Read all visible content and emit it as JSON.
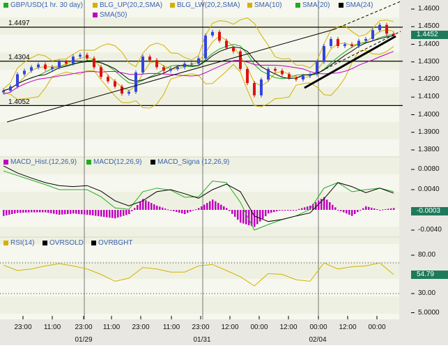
{
  "chart_data": {
    "type": "candlestick",
    "instrument": "GBP/USD(1 hr. 30 day)",
    "legend": [
      {
        "label": "GBP/USD(1 hr. 30 day)",
        "color": "#22aa22"
      },
      {
        "label": "BLG_UP(20,2,SMA)",
        "color": "#d4b000"
      },
      {
        "label": "BLG_LW(20,2,SMA)",
        "color": "#d4b000"
      },
      {
        "label": "SMA(10)",
        "color": "#d4b000"
      },
      {
        "label": "SMA(20)",
        "color": "#22aa22"
      },
      {
        "label": "SMA(24)",
        "color": "#000000"
      },
      {
        "label": "SMA(50)",
        "color": "#c000c0"
      }
    ],
    "closes": [
      1.4137,
      1.416,
      1.423,
      1.425,
      1.427,
      1.4285,
      1.426,
      1.427,
      1.43,
      1.429,
      1.433,
      1.434,
      1.432,
      1.427,
      1.4215,
      1.419,
      1.416,
      1.412,
      1.413,
      1.424,
      1.433,
      1.431,
      1.427,
      1.425,
      1.426,
      1.427,
      1.429,
      1.429,
      1.432,
      1.445,
      1.447,
      1.442,
      1.438,
      1.436,
      1.426,
      1.418,
      1.411,
      1.42,
      1.426,
      1.425,
      1.423,
      1.421,
      1.42,
      1.422,
      1.423,
      1.43,
      1.439,
      1.443,
      1.439,
      1.44,
      1.439,
      1.442,
      1.443,
      1.448,
      1.451,
      1.446,
      1.4452
    ],
    "levels": [
      {
        "label": "1.4497",
        "value": 1.4497
      },
      {
        "label": "1.4304",
        "value": 1.4304
      },
      {
        "label": "1.4052",
        "value": 1.4052
      }
    ],
    "price_axis": {
      "ylim": [
        1.375,
        1.465
      ],
      "ticks": [
        "1.4600",
        "1.4500",
        "1.4400",
        "1.4300",
        "1.4200",
        "1.4100",
        "1.4000",
        "1.3900",
        "1.3800"
      ],
      "tick_values": [
        1.46,
        1.45,
        1.44,
        1.43,
        1.42,
        1.41,
        1.4,
        1.39,
        1.38
      ],
      "last": "1.4452",
      "last_value": 1.4452
    },
    "macd_panel": {
      "legend": [
        {
          "label": "MACD_Hist.(12,26,9)",
          "color": "#c000c0"
        },
        {
          "label": "MACD(12,26,9)",
          "color": "#22aa22"
        },
        {
          "label": "MACD_Signa (12,26,9)",
          "color": "#000000"
        }
      ],
      "macd": [
        0.0077,
        0.0068,
        0.0059,
        0.005,
        0.004,
        0.004,
        0.004,
        0.0026,
        0.0004,
        0.0001,
        0.0036,
        0.0043,
        0.0039,
        0.0025,
        0.0026,
        0.0057,
        0.0054,
        0.0015,
        -0.004,
        -0.0029,
        -0.0019,
        -0.0012,
        0.0001,
        0.0043,
        0.0054,
        0.0036,
        0.004,
        0.0043,
        0.0036
      ],
      "signal": [
        0.0087,
        0.0073,
        0.0063,
        0.0054,
        0.0048,
        0.0046,
        0.0048,
        0.0037,
        0.0018,
        0.0008,
        0.0018,
        0.0036,
        0.004,
        0.0032,
        0.0023,
        0.004,
        0.0051,
        0.0036,
        -0.0012,
        -0.0023,
        -0.0019,
        -0.0012,
        -0.0006,
        0.0022,
        0.0054,
        0.0046,
        0.0034,
        0.0043,
        0.0033
      ],
      "ticks": [
        "0.0080",
        "0.0040",
        "-0.0040"
      ],
      "tick_values": [
        0.008,
        0.004,
        -0.004
      ],
      "last": "-0.0003",
      "last_value": -0.0003
    },
    "rsi_panel": {
      "legend": [
        {
          "label": "RSI(14)",
          "color": "#d4b000"
        },
        {
          "label": "OVRSOLD",
          "color": "#000000"
        },
        {
          "label": "OVRBGHT",
          "color": "#000000"
        }
      ],
      "rsi": [
        67,
        60,
        62,
        66,
        69,
        66,
        62,
        55,
        46,
        50,
        64,
        62,
        58,
        58,
        66,
        68,
        60,
        52,
        40,
        56,
        55,
        48,
        46,
        70,
        62,
        65,
        66,
        70,
        54.79
      ],
      "overbought": 70,
      "oversold": 30,
      "ticks": [
        "80.00",
        "30.00",
        "5.0000"
      ],
      "tick_values": [
        80,
        30,
        5
      ],
      "last": "54.79",
      "last_value": 54.79
    },
    "time_ticks": [
      "23:00",
      "11:00",
      "23:00",
      "11:00",
      "23:00",
      "11:00",
      "23:00",
      "12:00",
      "00:00",
      "12:00",
      "00:00",
      "12:00",
      "00:00"
    ],
    "date_labels": [
      "01/29",
      "01/31",
      "02/04"
    ]
  }
}
